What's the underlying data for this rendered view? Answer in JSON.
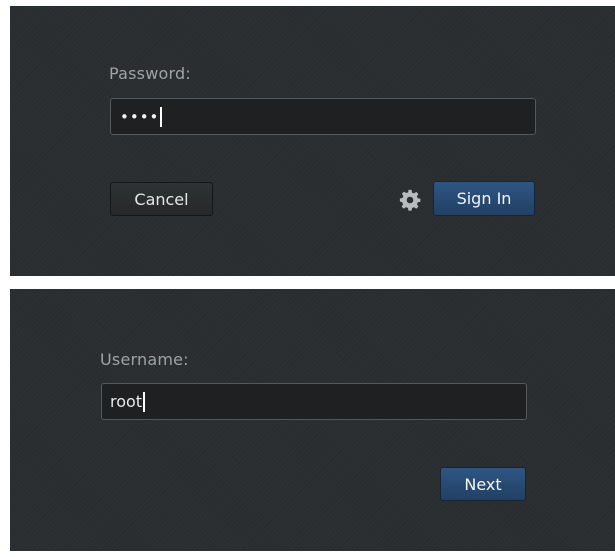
{
  "password_dialog": {
    "label": "Password:",
    "masked_value": "••••",
    "cancel_label": "Cancel",
    "signin_label": "Sign In",
    "settings_icon": "gear-icon"
  },
  "username_dialog": {
    "label": "Username:",
    "value": "root",
    "next_label": "Next"
  },
  "colors": {
    "background": "#2b2e30",
    "primary_button": "#2b4f7a",
    "label_text": "#9da3a6"
  }
}
